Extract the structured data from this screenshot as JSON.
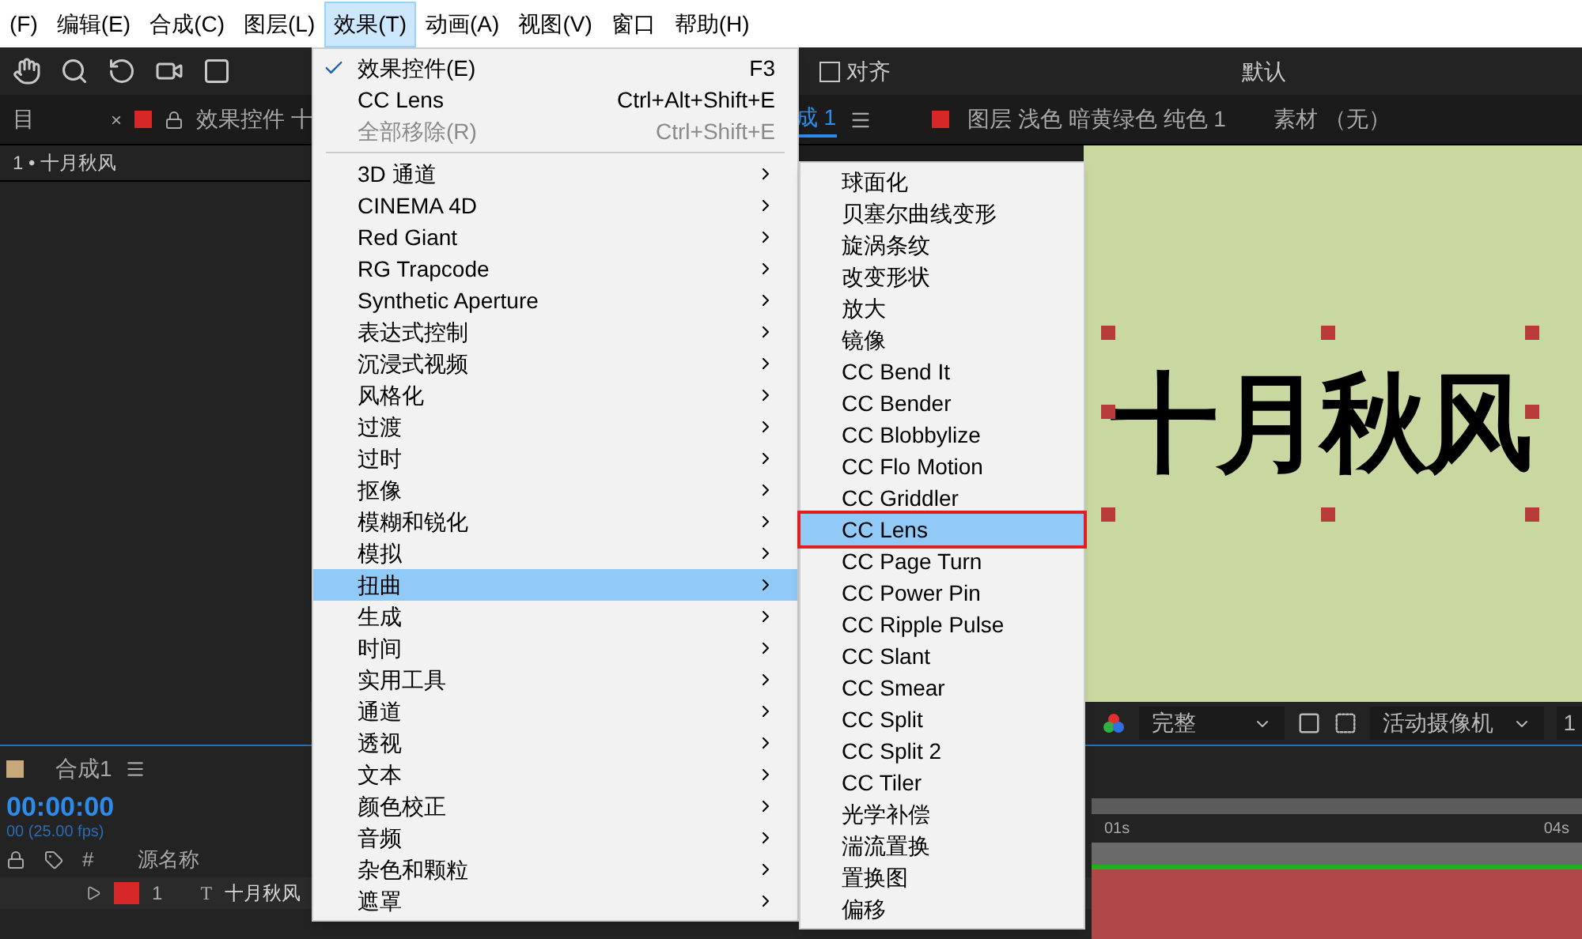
{
  "menubar": [
    {
      "label": "(F)",
      "selected": false
    },
    {
      "label": "编辑(E)",
      "selected": false
    },
    {
      "label": "合成(C)",
      "selected": false
    },
    {
      "label": "图层(L)",
      "selected": false
    },
    {
      "label": "效果(T)",
      "selected": true
    },
    {
      "label": "动画(A)",
      "selected": false
    },
    {
      "label": "视图(V)",
      "selected": false
    },
    {
      "label": "窗口",
      "selected": false
    },
    {
      "label": "帮助(H)",
      "selected": false
    }
  ],
  "toolbar": {
    "snap_label": "对齐",
    "snap_checked": false,
    "workspace": "默认"
  },
  "panel_tabs": {
    "close": "×",
    "tabs": [
      {
        "label": "目",
        "selected": false
      },
      {
        "label": "效果控件 十",
        "selected": false
      },
      {
        "label": "成 1",
        "selected": true
      },
      {
        "label": "图层 浅色 暗黄绿色 纯色 1",
        "selected": false
      },
      {
        "label": "素材 （无）",
        "selected": false
      }
    ]
  },
  "project_rows": [
    {
      "label": "1 • 十月秋风"
    }
  ],
  "viewer": {
    "text": "十月秋风",
    "resolution": "完整",
    "camera": "活动摄像机",
    "zoom_partial": "1"
  },
  "timeline": {
    "comp": "合成1",
    "timecode": "00:00:00",
    "fps": "00 (25.00 fps)",
    "column_hash": "#",
    "column_name": "源名称",
    "layer_number": "1",
    "layer_type": "T",
    "layer_name": "十月秋风",
    "ruler": [
      "01s",
      "04s"
    ]
  },
  "effects_menu": [
    {
      "kind": "item",
      "label": "效果控件(E)",
      "shortcut": "F3",
      "checked": true,
      "disabled": false,
      "selected": false
    },
    {
      "kind": "item",
      "label": "CC Lens",
      "shortcut": "Ctrl+Alt+Shift+E",
      "checked": false,
      "disabled": false,
      "selected": false
    },
    {
      "kind": "item",
      "label": "全部移除(R)",
      "shortcut": "Ctrl+Shift+E",
      "checked": false,
      "disabled": true,
      "selected": false
    },
    {
      "kind": "separator"
    },
    {
      "kind": "submenu",
      "label": "3D 通道",
      "selected": false
    },
    {
      "kind": "submenu",
      "label": "CINEMA 4D",
      "selected": false
    },
    {
      "kind": "submenu",
      "label": "Red Giant",
      "selected": false
    },
    {
      "kind": "submenu",
      "label": "RG Trapcode",
      "selected": false
    },
    {
      "kind": "submenu",
      "label": "Synthetic Aperture",
      "selected": false
    },
    {
      "kind": "submenu",
      "label": "表达式控制",
      "selected": false
    },
    {
      "kind": "submenu",
      "label": "沉浸式视频",
      "selected": false
    },
    {
      "kind": "submenu",
      "label": "风格化",
      "selected": false
    },
    {
      "kind": "submenu",
      "label": "过渡",
      "selected": false
    },
    {
      "kind": "submenu",
      "label": "过时",
      "selected": false
    },
    {
      "kind": "submenu",
      "label": "抠像",
      "selected": false
    },
    {
      "kind": "submenu",
      "label": "模糊和锐化",
      "selected": false
    },
    {
      "kind": "submenu",
      "label": "模拟",
      "selected": false
    },
    {
      "kind": "submenu",
      "label": "扭曲",
      "selected": true
    },
    {
      "kind": "submenu",
      "label": "生成",
      "selected": false
    },
    {
      "kind": "submenu",
      "label": "时间",
      "selected": false
    },
    {
      "kind": "submenu",
      "label": "实用工具",
      "selected": false
    },
    {
      "kind": "submenu",
      "label": "通道",
      "selected": false
    },
    {
      "kind": "submenu",
      "label": "透视",
      "selected": false
    },
    {
      "kind": "submenu",
      "label": "文本",
      "selected": false
    },
    {
      "kind": "submenu",
      "label": "颜色校正",
      "selected": false
    },
    {
      "kind": "submenu",
      "label": "音频",
      "selected": false
    },
    {
      "kind": "submenu",
      "label": "杂色和颗粒",
      "selected": false
    },
    {
      "kind": "submenu",
      "label": "遮罩",
      "selected": false
    }
  ],
  "distort_submenu": [
    {
      "label": "球面化",
      "selected": false
    },
    {
      "label": "贝塞尔曲线变形",
      "selected": false
    },
    {
      "label": "旋涡条纹",
      "selected": false
    },
    {
      "label": "改变形状",
      "selected": false
    },
    {
      "label": "放大",
      "selected": false
    },
    {
      "label": "镜像",
      "selected": false
    },
    {
      "label": "CC Bend It",
      "selected": false
    },
    {
      "label": "CC Bender",
      "selected": false
    },
    {
      "label": "CC Blobbylize",
      "selected": false
    },
    {
      "label": "CC Flo Motion",
      "selected": false
    },
    {
      "label": "CC Griddler",
      "selected": false
    },
    {
      "label": "CC Lens",
      "selected": true
    },
    {
      "label": "CC Page Turn",
      "selected": false
    },
    {
      "label": "CC Power Pin",
      "selected": false
    },
    {
      "label": "CC Ripple Pulse",
      "selected": false
    },
    {
      "label": "CC Slant",
      "selected": false
    },
    {
      "label": "CC Smear",
      "selected": false
    },
    {
      "label": "CC Split",
      "selected": false
    },
    {
      "label": "CC Split 2",
      "selected": false
    },
    {
      "label": "CC Tiler",
      "selected": false
    },
    {
      "label": "光学补偿",
      "selected": false
    },
    {
      "label": "湍流置换",
      "selected": false
    },
    {
      "label": "置换图",
      "selected": false
    },
    {
      "label": "偏移",
      "selected": false
    }
  ]
}
